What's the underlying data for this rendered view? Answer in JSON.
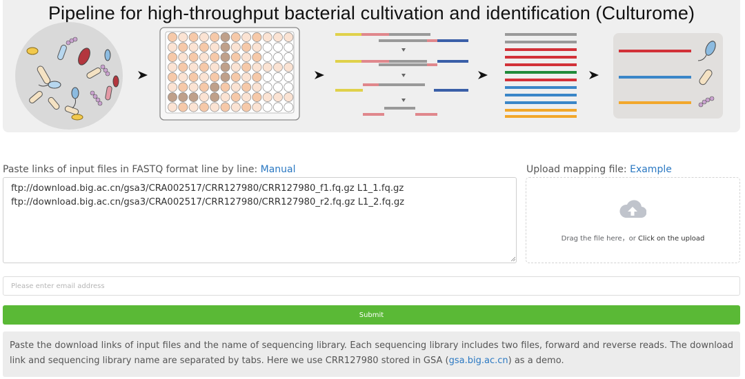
{
  "banner": {
    "title": "Pipeline for high-throughput bacterial cultivation and identification (Culturome)"
  },
  "form": {
    "links_label": "Paste links of input files in FASTQ format line by line: ",
    "links_manual_link": "Manual",
    "links_value": "ftp://download.big.ac.cn/gsa3/CRA002517/CRR127980/CRR127980_f1.fq.gz L1_1.fq.gz\nftp://download.big.ac.cn/gsa3/CRA002517/CRR127980/CRR127980_r2.fq.gz L1_2.fq.gz",
    "mapping_label": "Upload mapping file: ",
    "mapping_example_link": "Example",
    "upload_hint": "Drag the file here，or ",
    "upload_click": "Click on the upload",
    "email_placeholder": "Please enter email address",
    "email_value": "",
    "submit_label": "Submit"
  },
  "note": {
    "text_before": "Paste the download links of input files and the name of sequencing library. Each sequencing library includes two files, forward and reverse reads. The download link and sequencing library name are separated by tabs. Here we use CRR127980 stored in GSA (",
    "link_text": "gsa.big.ac.cn",
    "text_after": ") as a demo."
  },
  "colors": {
    "accent_link": "#2a78c2",
    "submit_green": "#5ab936",
    "note_bg": "#ececec",
    "banner_bg": "#efefef"
  },
  "icons": {
    "upload": "cloud-upload-icon",
    "arrow": "arrow-right-icon"
  }
}
